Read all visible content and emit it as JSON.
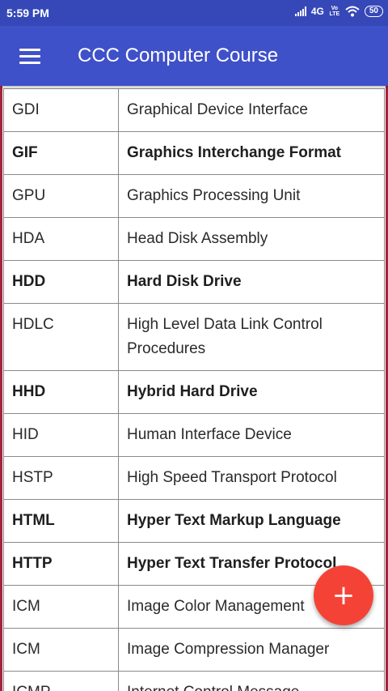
{
  "status_bar": {
    "time": "5:59 PM",
    "network": "4G",
    "volte": [
      "Vo",
      "LTE"
    ],
    "battery": "50"
  },
  "app_bar": {
    "menu_icon": "hamburger-menu-icon",
    "title": "CCC Computer Course"
  },
  "glossary": {
    "rows": [
      {
        "abbr": "GDI",
        "full": "Graphical Device Interface",
        "bold": false
      },
      {
        "abbr": "GIF",
        "full": "Graphics Interchange Format",
        "bold": true
      },
      {
        "abbr": "GPU",
        "full": "Graphics Processing Unit",
        "bold": false
      },
      {
        "abbr": "HDA",
        "full": "Head Disk Assembly",
        "bold": false
      },
      {
        "abbr": "HDD",
        "full": "Hard Disk Drive",
        "bold": true
      },
      {
        "abbr": "HDLC",
        "full": "High Level Data Link Control Procedures",
        "bold": false
      },
      {
        "abbr": "HHD",
        "full": "Hybrid Hard Drive",
        "bold": true
      },
      {
        "abbr": "HID",
        "full": "Human Interface Device",
        "bold": false
      },
      {
        "abbr": "HSTP",
        "full": "High Speed Transport Protocol",
        "bold": false
      },
      {
        "abbr": "HTML",
        "full": "Hyper Text Markup Language",
        "bold": true
      },
      {
        "abbr": "HTTP",
        "full": "Hyper Text Transfer Protocol",
        "bold": true
      },
      {
        "abbr": "ICM",
        "full": "Image Color Management",
        "bold": false
      },
      {
        "abbr": "ICM",
        "full": "Image Compression Manager",
        "bold": false
      },
      {
        "abbr": "ICMP",
        "full": "Internet Control Message",
        "bold": false
      }
    ]
  },
  "fab": {
    "icon": "plus-icon",
    "symbol": "+",
    "color": "#f44336"
  },
  "colors": {
    "status_bar": "#3648b8",
    "app_bar": "#3f51c8",
    "frame": "#a4243d"
  }
}
